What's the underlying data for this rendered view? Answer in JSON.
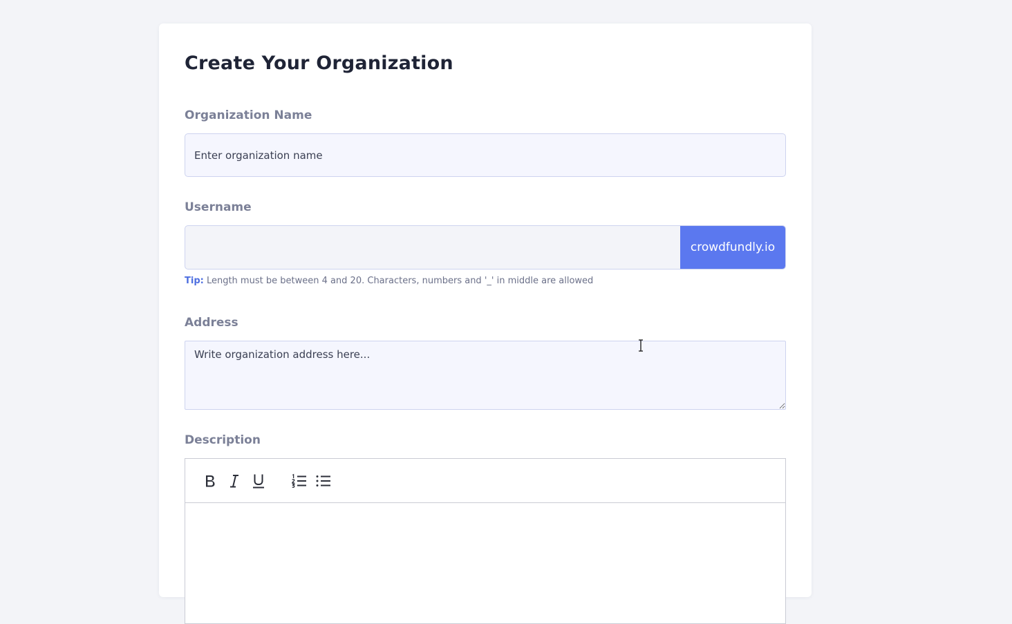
{
  "form": {
    "title": "Create Your Organization",
    "org_name": {
      "label": "Organization Name",
      "placeholder": "Enter organization name",
      "value": ""
    },
    "username": {
      "label": "Username",
      "value": "",
      "suffix": "crowdfundly.io",
      "tip_label": "Tip:",
      "tip_text": " Length must be between 4 and 20. Characters, numbers and '_' in middle are allowed"
    },
    "address": {
      "label": "Address",
      "placeholder": "Write organization address here...",
      "value": ""
    },
    "description": {
      "label": "Description",
      "toolbar": [
        {
          "name": "bold-icon",
          "title": "Bold"
        },
        {
          "name": "italic-icon",
          "title": "Italic"
        },
        {
          "name": "underline-icon",
          "title": "Underline"
        },
        {
          "name": "ordered-list-icon",
          "title": "Ordered List"
        },
        {
          "name": "bullet-list-icon",
          "title": "Bullet List"
        }
      ]
    }
  },
  "colors": {
    "page_bg": "#f3f4f8",
    "card_bg": "#ffffff",
    "accent": "#5b78ef",
    "input_bg": "#f5f6fe",
    "input_border": "#cdd3ef",
    "label": "#7b8097",
    "title": "#1f2436",
    "tip_label": "#4e6fe0"
  }
}
